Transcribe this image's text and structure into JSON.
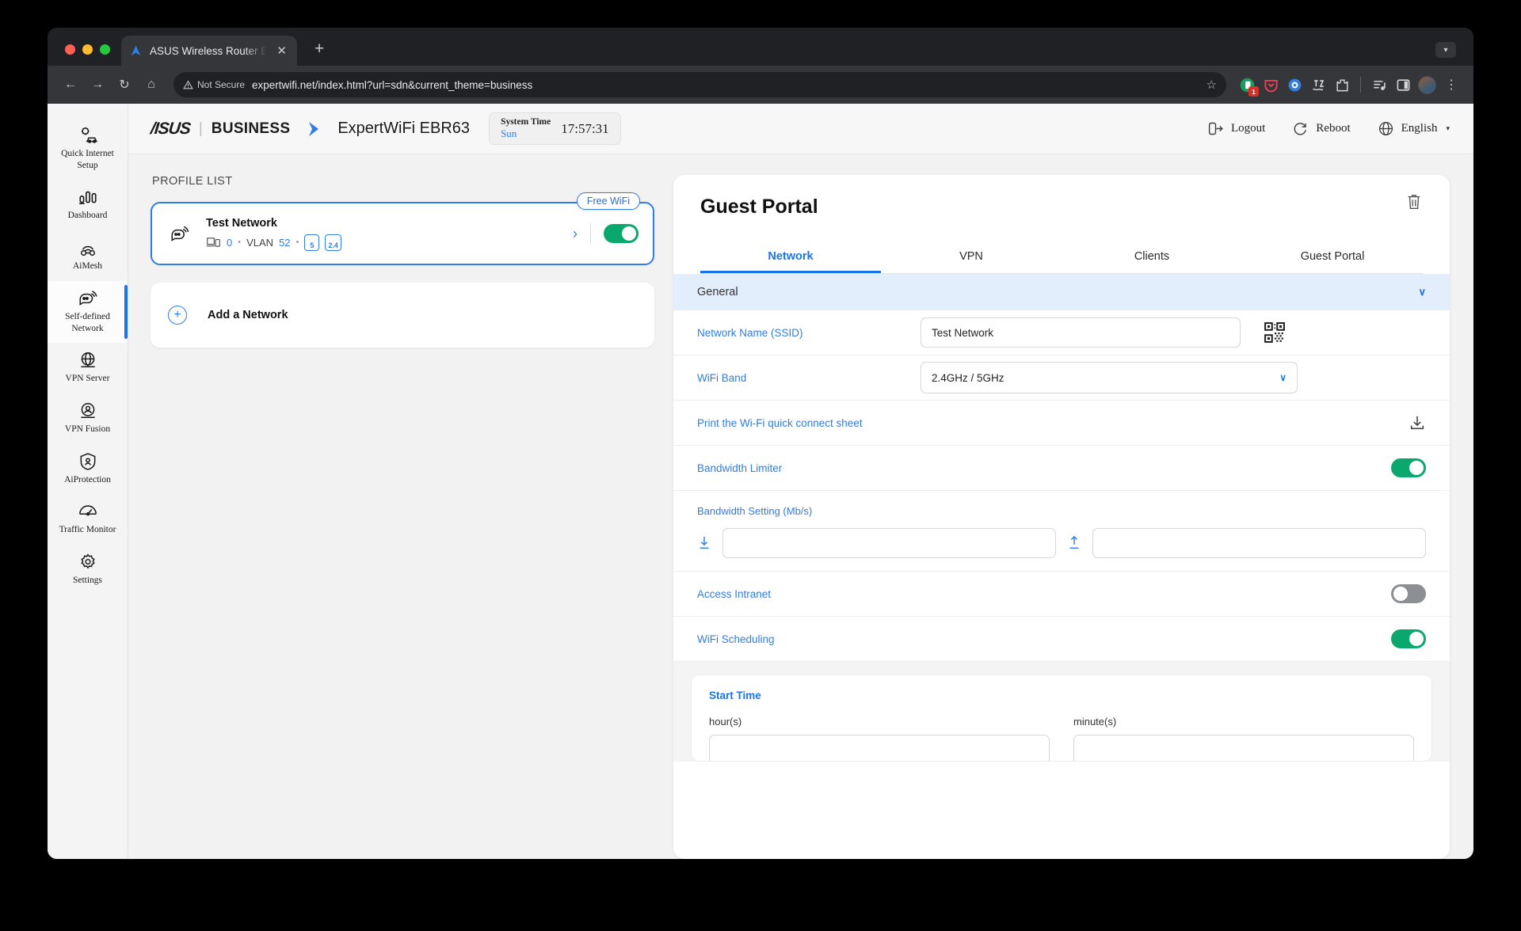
{
  "browser": {
    "tab": {
      "title": "ASUS Wireless Router Expert",
      "favicon": "asus-logo-icon",
      "close": "✕"
    },
    "new_tab": "+",
    "window_chevron": "▾",
    "nav": {
      "back": "←",
      "forward": "→",
      "reload": "↻",
      "home": "⌂"
    },
    "omnibox": {
      "security_label": "Not Secure",
      "security_icon": "warning-triangle-icon",
      "url": "expertwifi.net/index.html?url=sdn&current_theme=business",
      "bookmark_icon": "star-icon"
    },
    "extensions": [
      {
        "name": "extension-badge-icon",
        "badge": "1"
      },
      {
        "name": "pocket-icon",
        "badge": ""
      },
      {
        "name": "translate-globe-icon",
        "badge": ""
      },
      {
        "name": "ink-icon",
        "badge": ""
      },
      {
        "name": "puzzle-extensions-icon",
        "badge": ""
      }
    ],
    "toolbar_right": [
      {
        "name": "reading-list-icon"
      },
      {
        "name": "side-panel-icon"
      },
      {
        "name": "profile-avatar"
      },
      {
        "name": "chrome-menu-icon",
        "label": "⋮"
      }
    ]
  },
  "router_header": {
    "brand": "/ISUS",
    "divider": "|",
    "business": "BUSINESS",
    "model": "ExpertWiFi EBR63",
    "system_time_label": "System Time",
    "system_time_day": "Sun",
    "system_time_clock": "17:57:31",
    "logout": "Logout",
    "reboot": "Reboot",
    "language": "English",
    "language_chevron": "▾"
  },
  "sidebar": {
    "items": [
      {
        "label": "Quick Internet Setup",
        "icon": "quick-setup-icon",
        "active": false
      },
      {
        "label": "Dashboard",
        "icon": "dashboard-bars-icon",
        "active": false
      },
      {
        "label": "AiMesh",
        "icon": "aimesh-icon",
        "active": false
      },
      {
        "label": "Self-defined Network",
        "icon": "self-defined-network-icon",
        "active": true
      },
      {
        "label": "VPN Server",
        "icon": "vpn-server-icon",
        "active": false
      },
      {
        "label": "VPN Fusion",
        "icon": "vpn-fusion-icon",
        "active": false
      },
      {
        "label": "AiProtection",
        "icon": "shield-icon",
        "active": false
      },
      {
        "label": "Traffic Monitor",
        "icon": "traffic-monitor-icon",
        "active": false
      },
      {
        "label": "Settings",
        "icon": "gear-icon",
        "active": false
      }
    ]
  },
  "profile_list": {
    "title": "PROFILE LIST",
    "profile": {
      "badge": "Free WiFi",
      "icon": "guest-network-icon",
      "name": "Test Network",
      "client_icon": "device-icon",
      "client_count": "0",
      "sep1": "•",
      "vlan_label": "VLAN",
      "vlan_value": "52",
      "sep2": "•",
      "bands": [
        "5",
        "2.4"
      ],
      "chevron": "›",
      "toggle_on": true
    },
    "add_network": {
      "label": "Add a Network",
      "icon": "plus-circle-icon"
    }
  },
  "panel": {
    "title": "Guest Portal",
    "delete_icon": "trash-icon",
    "tabs": [
      {
        "label": "Network",
        "active": true
      },
      {
        "label": "VPN",
        "active": false
      },
      {
        "label": "Clients",
        "active": false
      },
      {
        "label": "Guest Portal",
        "active": false
      }
    ],
    "accordion": {
      "label": "General",
      "chevron": "∨"
    },
    "rows": {
      "ssid": {
        "label": "Network Name (SSID)",
        "value": "Test Network",
        "qr_icon": "qr-code-icon"
      },
      "band": {
        "label": "WiFi Band",
        "value": "2.4GHz / 5GHz",
        "chevron": "∨"
      },
      "print_sheet": {
        "label": "Print the Wi-Fi quick connect sheet",
        "icon": "download-icon"
      },
      "bandwidth_limiter": {
        "label": "Bandwidth Limiter",
        "toggle_on": true
      },
      "bandwidth_setting": {
        "label": "Bandwidth Setting (Mb/s)",
        "download_icon": "download-arrow-icon",
        "download_value": "",
        "upload_icon": "upload-arrow-icon",
        "upload_value": ""
      },
      "access_intranet": {
        "label": "Access Intranet",
        "toggle_on": false
      },
      "wifi_scheduling": {
        "label": "WiFi Scheduling",
        "toggle_on": true
      }
    },
    "schedule": {
      "title": "Start Time",
      "hour_label": "hour(s)",
      "hour_value": "",
      "minute_label": "minute(s)",
      "minute_value": ""
    }
  },
  "colors": {
    "accent_blue": "#1a73e8",
    "link_blue": "#2f7de1",
    "toggle_on": "#0aa86e",
    "toggle_off": "#8c8f93",
    "accordion_bg": "#e3eefc",
    "page_bg": "#f2f2f2"
  }
}
